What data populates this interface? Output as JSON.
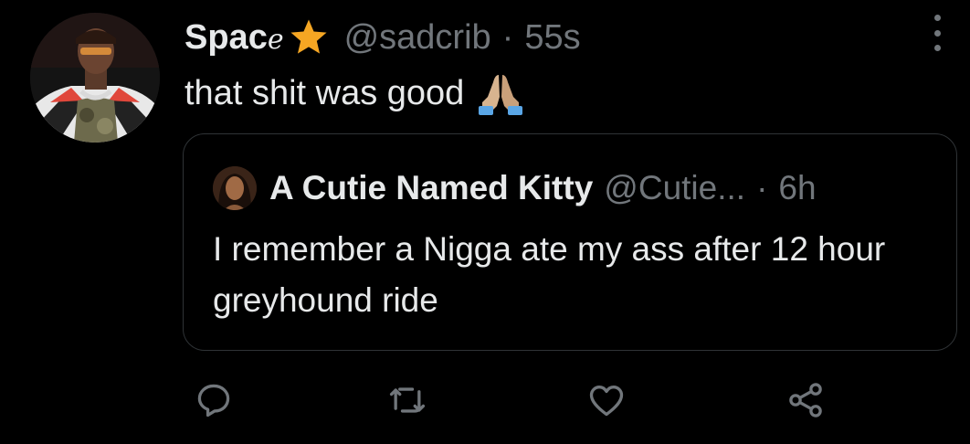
{
  "tweet": {
    "display_name_main": "Spac",
    "display_name_script": "e",
    "handle": "@sadcrib",
    "separator": "·",
    "time": "55s",
    "text": "that shit was good"
  },
  "quote": {
    "display_name": "A Cutie Named Kitty",
    "handle": "@Cutie...",
    "separator": "·",
    "time": "6h",
    "text": "I remember a Nigga ate my ass after 12 hour greyhound ride"
  },
  "actions": {
    "reply_icon": "reply-icon",
    "retweet_icon": "retweet-icon",
    "like_icon": "heart-icon",
    "share_icon": "share-icon"
  },
  "colors": {
    "background": "#000000",
    "text_primary": "#e7e9ea",
    "text_secondary": "#71767b",
    "border": "#2f3336",
    "star": "#f5a623"
  }
}
